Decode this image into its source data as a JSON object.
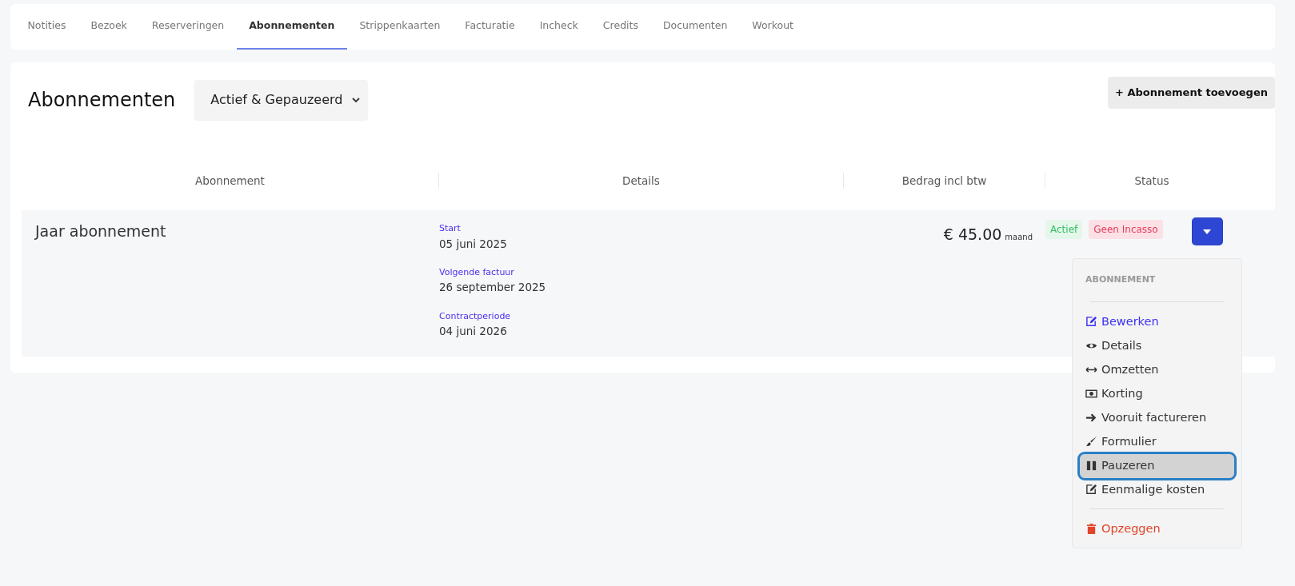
{
  "tabs": [
    {
      "label": "Notities",
      "selected": false
    },
    {
      "label": "Bezoek",
      "selected": false
    },
    {
      "label": "Reserveringen",
      "selected": false
    },
    {
      "label": "Abonnementen",
      "selected": true
    },
    {
      "label": "Strippenkaarten",
      "selected": false
    },
    {
      "label": "Facturatie",
      "selected": false
    },
    {
      "label": "Incheck",
      "selected": false
    },
    {
      "label": "Credits",
      "selected": false
    },
    {
      "label": "Documenten",
      "selected": false
    },
    {
      "label": "Workout",
      "selected": false
    }
  ],
  "page_title": "Abonnementen",
  "filter": {
    "value": "Actief & Gepauzeerd"
  },
  "add_button": "+ Abonnement toevoegen",
  "table": {
    "columns": [
      "Abonnement",
      "Details",
      "Bedrag incl btw",
      "Status"
    ],
    "rows": [
      {
        "name": "Jaar abonnement",
        "details": [
          {
            "label": "Start",
            "value": "05 juni 2025"
          },
          {
            "label": "Volgende factuur",
            "value": "26 september 2025"
          },
          {
            "label": "Contractperiode",
            "value": "04 juni 2026"
          }
        ],
        "amount": "€ 45.00",
        "period": "maand",
        "badges": [
          {
            "label": "Actief",
            "kind": "success"
          },
          {
            "label": "Geen Incasso",
            "kind": "danger"
          }
        ],
        "menu": {
          "expanded": true,
          "items": [
            {
              "kind": "header",
              "label": "ABONNEMENT"
            },
            {
              "kind": "divider"
            },
            {
              "kind": "primary",
              "label": "Bewerken",
              "focused": false
            },
            {
              "kind": "item",
              "label": "Details",
              "focused": false
            },
            {
              "kind": "item",
              "label": "Omzetten",
              "focused": false
            },
            {
              "kind": "item",
              "label": "Korting",
              "focused": false
            },
            {
              "kind": "item",
              "label": "Vooruit factureren",
              "focused": false
            },
            {
              "kind": "item",
              "label": "Formulier",
              "focused": false
            },
            {
              "kind": "item",
              "label": "Pauzeren",
              "focused": true
            },
            {
              "kind": "item",
              "label": "Eenmalige kosten",
              "focused": false
            },
            {
              "kind": "divider"
            },
            {
              "kind": "danger",
              "label": "Opzeggen",
              "focused": false
            }
          ]
        }
      }
    ]
  }
}
